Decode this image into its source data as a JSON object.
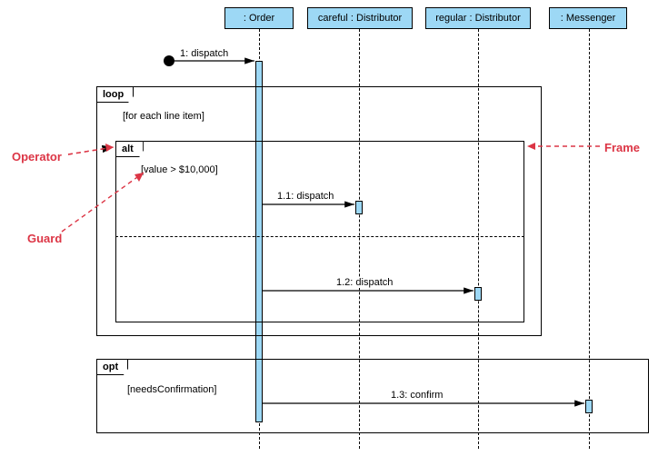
{
  "lifelines": {
    "order": ": Order",
    "careful": "careful : Distributor",
    "regular": "regular : Distributor",
    "messenger": ": Messenger"
  },
  "frames": {
    "loop": {
      "tag": "loop",
      "guard": "[for each line item]"
    },
    "alt": {
      "tag": "alt",
      "guard": "[value > $10,000]"
    },
    "opt": {
      "tag": "opt",
      "guard": "[needsConfirmation]"
    }
  },
  "messages": {
    "m1": "1: dispatch",
    "m11": "1.1: dispatch",
    "m12": "1.2: dispatch",
    "m13": "1.3: confirm"
  },
  "annotations": {
    "operator": "Operator",
    "guard": "Guard",
    "frame": "Frame"
  },
  "chart_data": {
    "type": "uml-sequence-diagram",
    "lifelines": [
      {
        "id": "order",
        "label": ": Order"
      },
      {
        "id": "careful",
        "label": "careful : Distributor"
      },
      {
        "id": "regular",
        "label": "regular : Distributor"
      },
      {
        "id": "messenger",
        "label": ": Messenger"
      }
    ],
    "messages": [
      {
        "seq": "1",
        "name": "dispatch",
        "from": "start",
        "to": "order"
      },
      {
        "seq": "1.1",
        "name": "dispatch",
        "from": "order",
        "to": "careful",
        "frame": "alt",
        "guard": "value > $10,000"
      },
      {
        "seq": "1.2",
        "name": "dispatch",
        "from": "order",
        "to": "regular",
        "frame": "alt-else"
      },
      {
        "seq": "1.3",
        "name": "confirm",
        "from": "order",
        "to": "messenger",
        "frame": "opt",
        "guard": "needsConfirmation"
      }
    ],
    "fragments": [
      {
        "operator": "loop",
        "guard": "for each line item",
        "contains": [
          "alt"
        ]
      },
      {
        "operator": "alt",
        "guards": [
          "value > $10,000",
          ""
        ],
        "messages": [
          "1.1",
          "1.2"
        ]
      },
      {
        "operator": "opt",
        "guard": "needsConfirmation",
        "messages": [
          "1.3"
        ]
      }
    ],
    "annotations": [
      "Operator",
      "Guard",
      "Frame"
    ]
  }
}
